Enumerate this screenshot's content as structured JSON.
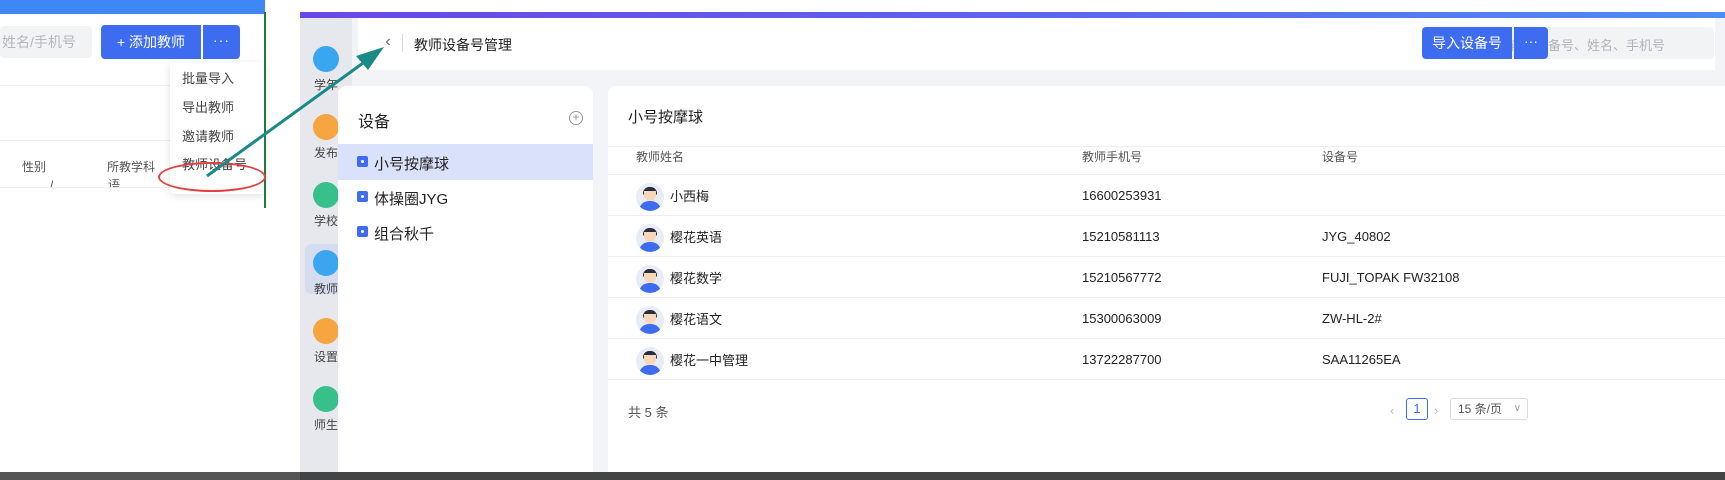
{
  "left_panel": {
    "search_placeholder": "姓名/手机号",
    "add_teacher": "+ 添加教师",
    "more": "···",
    "table_headers": [
      "性别",
      "所教学科"
    ],
    "row_fragment": [
      "/",
      "语"
    ],
    "dropdown_items": [
      "批量导入",
      "导出教师",
      "邀请教师",
      "教师设备号"
    ]
  },
  "rail": {
    "items": [
      {
        "label": "学年",
        "icon": "school-year-icon",
        "color": "#3aa6f0"
      },
      {
        "label": "发布",
        "icon": "publish-icon",
        "color": "#f6a540"
      },
      {
        "label": "学校",
        "icon": "school-icon",
        "color": "#37c08a"
      },
      {
        "label": "教师",
        "icon": "teacher-icon",
        "color": "#3aa6f0",
        "active": true
      },
      {
        "label": "设置",
        "icon": "settings-icon",
        "color": "#f6a540"
      },
      {
        "label": "师生",
        "icon": "teacher-student-icon",
        "color": "#37c08a"
      }
    ]
  },
  "header": {
    "title": "教师设备号管理",
    "search_placeholder": "请输入设备号、姓名、手机号",
    "import_button": "导入设备号",
    "more_button": "···"
  },
  "devices": {
    "title": "设备",
    "items": [
      {
        "label": "小号按摩球",
        "active": true
      },
      {
        "label": "体操圈JYG",
        "active": false
      },
      {
        "label": "组合秋千",
        "active": false
      }
    ]
  },
  "table": {
    "title": "小号按摩球",
    "columns": [
      "教师姓名",
      "教师手机号",
      "设备号"
    ],
    "rows": [
      {
        "name": "小西梅",
        "phone": "16600253931",
        "device": ""
      },
      {
        "name": "樱花英语",
        "phone": "15210581113",
        "device": "JYG_40802"
      },
      {
        "name": "樱花数学",
        "phone": "15210567772",
        "device": "FUJI_TOPAK FW32108"
      },
      {
        "name": "樱花语文",
        "phone": "15300063009",
        "device": "ZW-HL-2#"
      },
      {
        "name": "樱花一中管理",
        "phone": "13722287700",
        "device": "SAA11265EA"
      }
    ],
    "total": "共 5 条",
    "current_page": "1",
    "page_size": "15 条/页"
  },
  "colors": {
    "primary": "#3d6cf0",
    "selected_bg": "#d9e1fb",
    "annotation_red": "#e04040",
    "annotation_arrow": "#1a8a86"
  }
}
